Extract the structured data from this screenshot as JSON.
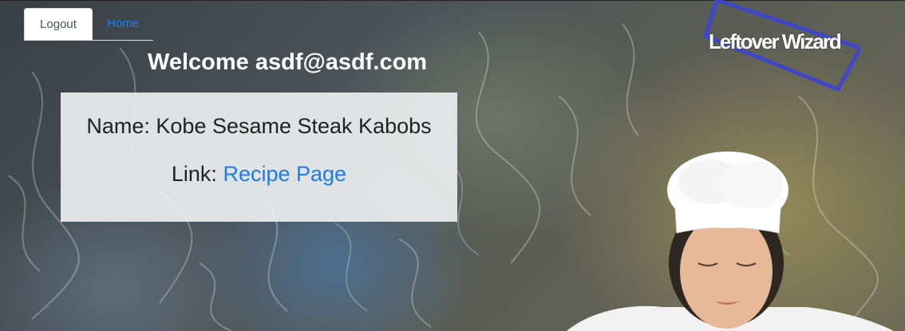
{
  "nav": {
    "tabs": [
      {
        "label": "Logout",
        "active": true
      },
      {
        "label": "Home",
        "active": false
      }
    ]
  },
  "brand": {
    "name": "Leftover Wizard",
    "frame_color": "#3f47c8"
  },
  "welcome": {
    "text": "Welcome asdf@asdf.com"
  },
  "recipe": {
    "name_label": "Name:",
    "name_value": "Kobe Sesame Steak Kabobs",
    "link_label": "Link:",
    "link_text": "Recipe Page"
  },
  "colors": {
    "link": "#1a7cf2",
    "text_light": "#ffffff"
  }
}
